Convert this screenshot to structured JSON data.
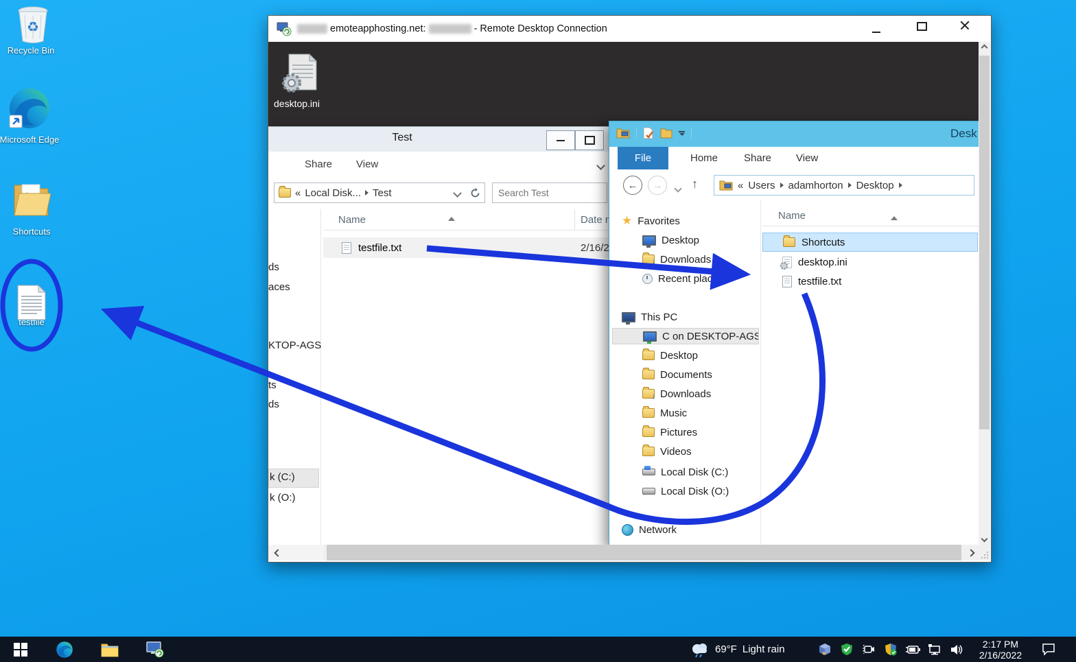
{
  "colors": {
    "wallpaper": "#10a3ee",
    "annotation_blue": "#1a35dc",
    "titlebar_2012": "#5fc3e9",
    "file_tab_blue": "#2a7cc0",
    "selection_blue": "#cce8ff",
    "taskbar": "#0d1523"
  },
  "desktop": {
    "icons": [
      {
        "label": "Recycle Bin"
      },
      {
        "label": "Microsoft Edge"
      },
      {
        "label": "Shortcuts"
      },
      {
        "label": "testfile"
      }
    ]
  },
  "rdp": {
    "title": {
      "host": "emoteapphosting.net:",
      "suffix": "- Remote Desktop Connection"
    },
    "remote": {
      "desktop_ini_label": "desktop.ini"
    }
  },
  "test_window": {
    "title": "Test",
    "tabs": {
      "share": "Share",
      "view": "View"
    },
    "address": {
      "prefix": "«",
      "crumb1": "Local Disk...",
      "crumb2": "Test"
    },
    "search_placeholder": "Search Test",
    "columns": {
      "name": "Name",
      "date": "Date m"
    },
    "file": {
      "name": "testfile.txt",
      "date": "2/16/2"
    },
    "nav_fragments": [
      "ds",
      "aces",
      "KTOP-AGS",
      "ts",
      "ds",
      "k (C:)",
      "k (O:)"
    ]
  },
  "desktop_window": {
    "title": "Desk",
    "tabs": {
      "file": "File",
      "home": "Home",
      "share": "Share",
      "view": "View"
    },
    "address": {
      "prefix": "«",
      "crumb1": "Users",
      "crumb2": "adamhorton",
      "crumb3": "Desktop"
    },
    "nav": {
      "favorites": {
        "label": "Favorites",
        "items": [
          {
            "label": "Desktop"
          },
          {
            "label": "Downloads"
          },
          {
            "label": "Recent places"
          }
        ]
      },
      "this_pc": {
        "label": "This PC",
        "items": [
          {
            "label": "C on DESKTOP-AGS"
          },
          {
            "label": "Desktop"
          },
          {
            "label": "Documents"
          },
          {
            "label": "Downloads"
          },
          {
            "label": "Music"
          },
          {
            "label": "Pictures"
          },
          {
            "label": "Videos"
          },
          {
            "label": "Local Disk (C:)"
          },
          {
            "label": "Local Disk (O:)"
          }
        ]
      },
      "network": {
        "label": "Network"
      }
    },
    "columns": {
      "name": "Name"
    },
    "files": [
      {
        "name": "Shortcuts"
      },
      {
        "name": "desktop.ini"
      },
      {
        "name": "testfile.txt"
      }
    ]
  },
  "taskbar": {
    "weather": {
      "temperature": "69°F",
      "condition": "Light rain"
    },
    "clock": {
      "time": "2:17 PM",
      "date": "2/16/2022"
    }
  }
}
